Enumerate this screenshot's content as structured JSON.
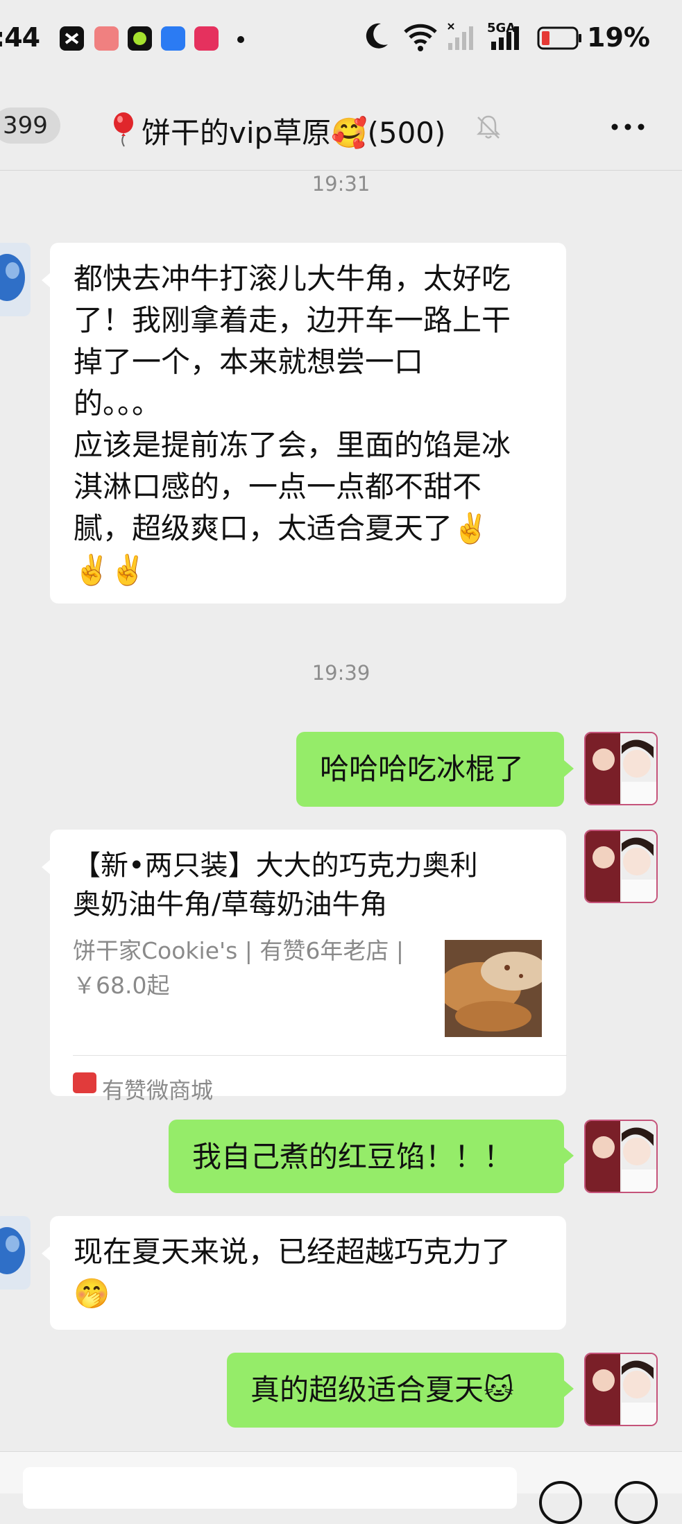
{
  "status_bar": {
    "time": ":44",
    "battery": "19%",
    "network": "5GA"
  },
  "header": {
    "back_count": "399",
    "title": "饼干的vip草原🥰(500)"
  },
  "messages": {
    "ts1": "19:31",
    "m1_lines": [
      "都快去冲牛打滚儿大牛角，太好吃",
      "了！我刚拿着走，边开车一路上干",
      "掉了一个，本来就想尝一口",
      "的。。。",
      "应该是提前冻了会，里面的馅是冰",
      "淇淋口感的，一点一点都不甜不",
      "腻，超级爽口，太适合夏天了✌️",
      "✌️✌️"
    ],
    "ts2": "19:39",
    "m2": "哈哈哈吃冰棍了",
    "card": {
      "title_line1": "【新•两只装】大大的巧克力奥利",
      "title_line2": "奥奶油牛角/草莓奶油牛角",
      "meta_line1": "饼干家Cookie's | 有赞6年老店 |",
      "meta_line2": "￥68.0起",
      "source": "有赞微商城"
    },
    "m3": "我自己煮的红豆馅！！！",
    "m4_line1": "现在夏天来说，已经超越巧克力了",
    "m4_line2": "🤭",
    "m5": "真的超级适合夏天🐱"
  },
  "colors": {
    "outgoing_bubble": "#95ec69",
    "incoming_bubble": "#ffffff",
    "background": "#ededed"
  }
}
